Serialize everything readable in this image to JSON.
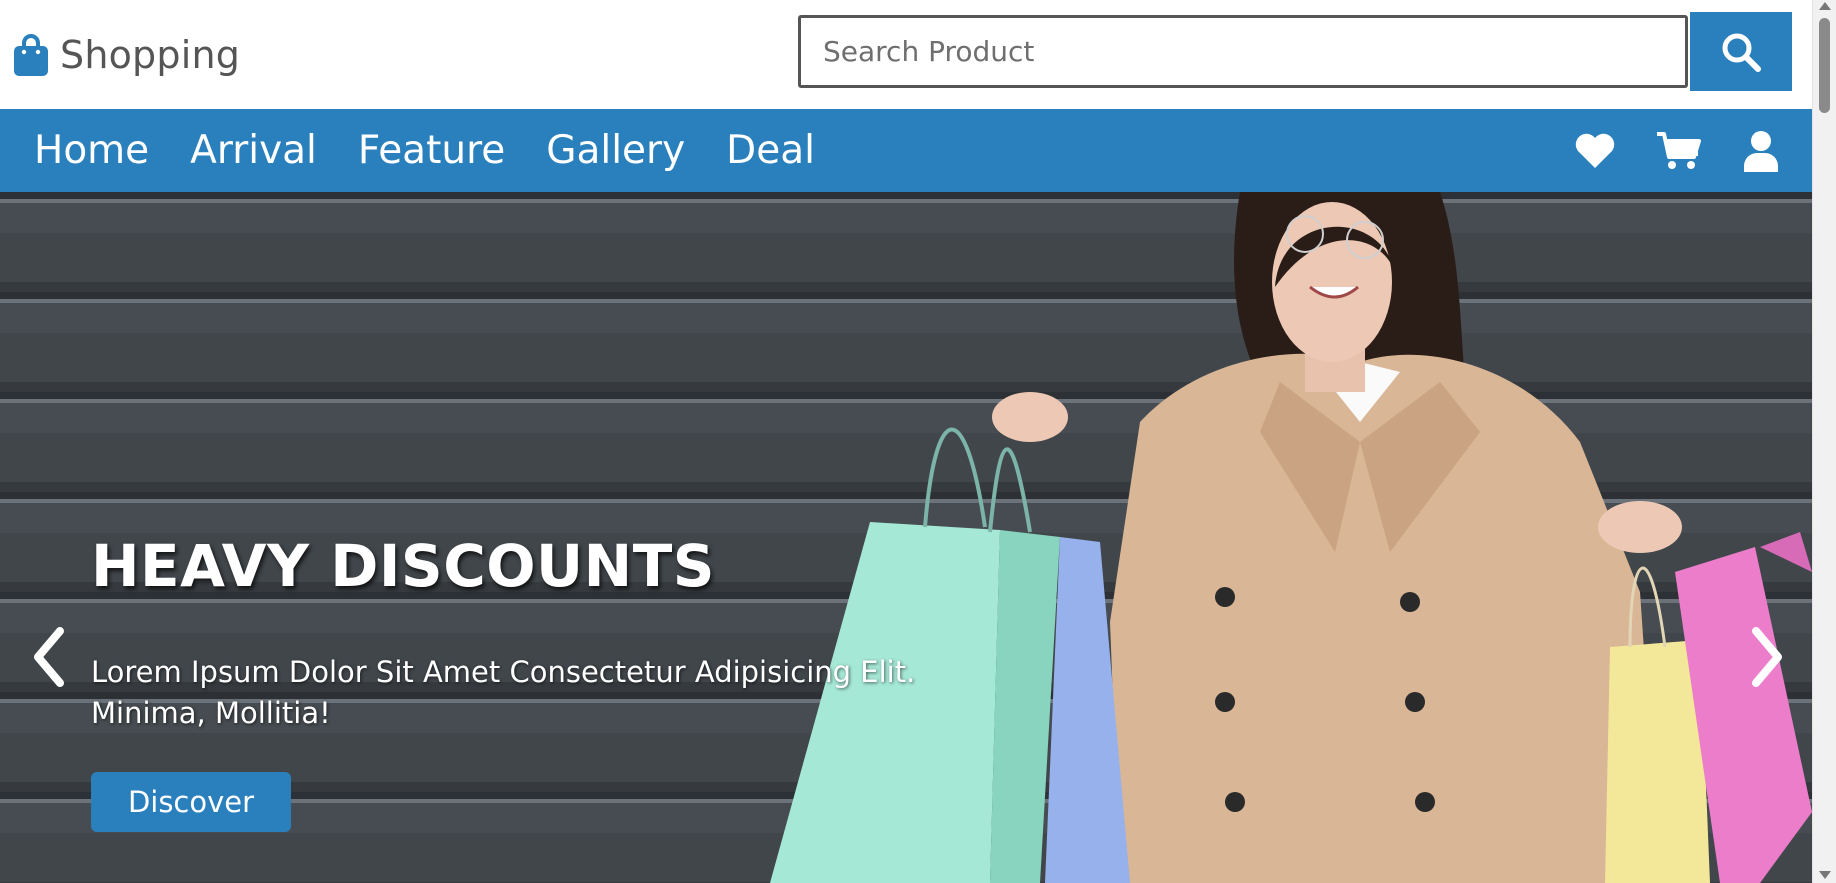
{
  "brand": {
    "name": "Shopping",
    "icon": "shopping-bag-icon"
  },
  "search": {
    "placeholder": "Search Product",
    "value": "",
    "icon": "search-icon"
  },
  "nav": {
    "links": [
      "Home",
      "Arrival",
      "Feature",
      "Gallery",
      "Deal"
    ],
    "icons": [
      "heart-icon",
      "cart-icon",
      "user-icon"
    ]
  },
  "hero": {
    "title": "HEAVY DISCOUNTS",
    "description": "Lorem Ipsum Dolor Sit Amet Consectetur Adipisicing Elit. Minima, Mollitia!",
    "button_label": "Discover",
    "prev_icon": "chevron-left-icon",
    "next_icon": "chevron-right-icon"
  },
  "colors": {
    "primary": "#2a7fbd",
    "text_dark": "#555555",
    "hero_background": "#3f4448",
    "white": "#ffffff"
  }
}
